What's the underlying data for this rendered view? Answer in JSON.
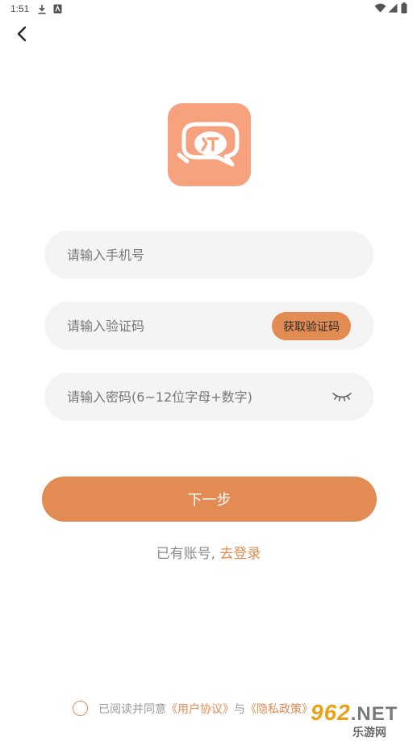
{
  "status_bar": {
    "time": "1:51",
    "left_icons": [
      "download-icon",
      "app-notification-icon"
    ],
    "right_icons": [
      "wifi-icon",
      "signal-icon",
      "battery-icon"
    ]
  },
  "header": {
    "back_icon": "chevron-left-icon"
  },
  "logo": {
    "icon": "chat-bubbles-logo",
    "color": "#f6a27f"
  },
  "form": {
    "phone": {
      "placeholder": "请输入手机号",
      "value": ""
    },
    "code": {
      "placeholder": "请输入验证码",
      "value": "",
      "button_label": "获取验证码"
    },
    "password": {
      "placeholder": "请输入密码(6~12位字母+数字)",
      "value": "",
      "toggle_icon": "eye-closed-icon"
    }
  },
  "next_button": {
    "label": "下一步"
  },
  "login": {
    "prompt": "已有账号, ",
    "link": "去登录"
  },
  "agreement": {
    "prefix": "已阅读并同意",
    "user_agreement": "《用户协议》",
    "conjunction": "与",
    "privacy_policy": "《隐私政策》",
    "checked": false
  },
  "watermark": {
    "number": "962",
    "domain": ".NET",
    "site": "乐游网"
  },
  "colors": {
    "accent": "#e28b52",
    "logo": "#f6a27f",
    "field_bg": "#f4f4f4"
  }
}
